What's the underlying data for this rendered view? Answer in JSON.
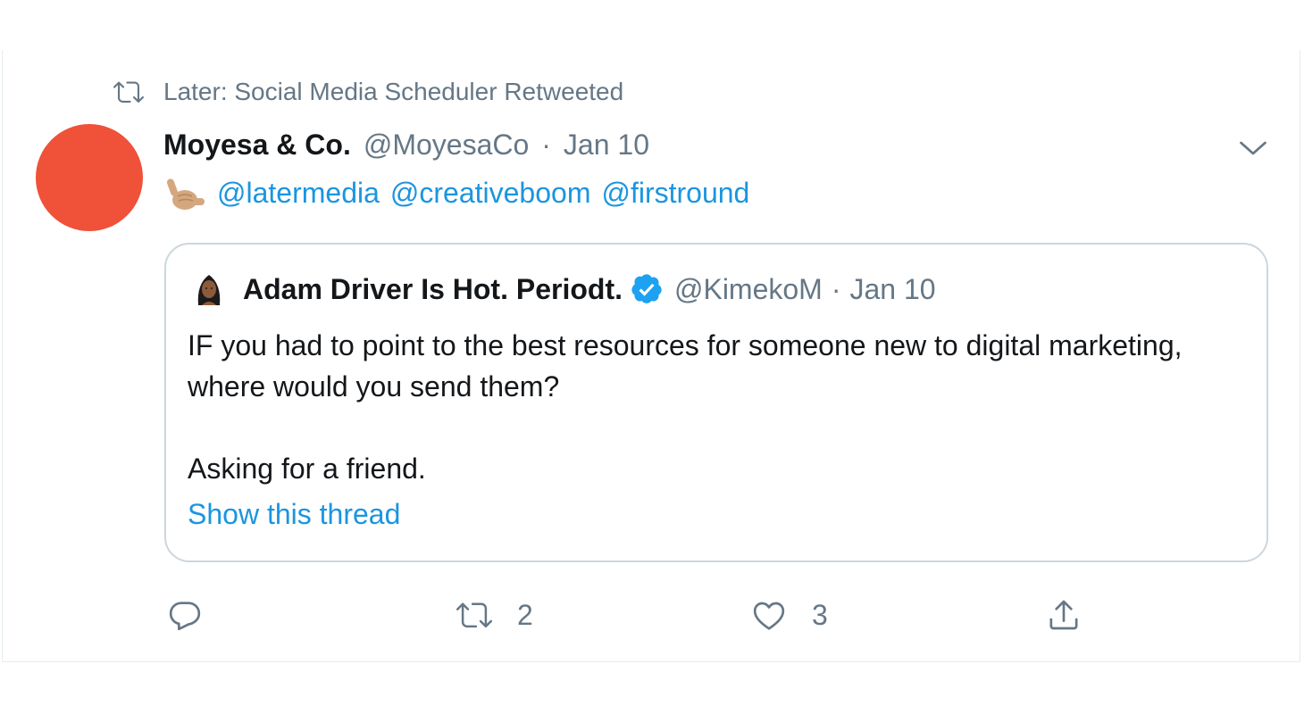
{
  "retweet_context": {
    "text": "Later: Social Media Scheduler Retweeted",
    "icon": "retweet-icon"
  },
  "tweet": {
    "avatar_color": "#ef5139",
    "author_name": "Moyesa & Co.",
    "handle": "@MoyesaCo",
    "separator": "·",
    "date": "Jan 10",
    "emoji": "call-me-hand-emoji",
    "mentions": [
      "@latermedia",
      "@creativeboom",
      "@firstround"
    ],
    "menu_icon": "chevron-down-icon"
  },
  "quote": {
    "author_name": "Adam Driver Is Hot. Periodt.",
    "verified_icon": "verified-badge-icon",
    "handle": "@KimekoM",
    "separator": "·",
    "date": "Jan 10",
    "text_line1": "IF you had to point to the best resources for someone new to digital marketing, where would you send them?",
    "text_line2": "Asking for a friend.",
    "thread_link": "Show this thread"
  },
  "actions": {
    "reply": {
      "icon": "reply-icon",
      "count": ""
    },
    "retweet": {
      "icon": "retweet-icon",
      "count": "2"
    },
    "like": {
      "icon": "heart-icon",
      "count": "3"
    },
    "share": {
      "icon": "share-icon",
      "count": ""
    }
  },
  "colors": {
    "link": "#1b95e0",
    "secondary_text": "#657786",
    "primary_text": "#14171a",
    "border": "#ccd6dd",
    "verified": "#1da1f2"
  }
}
